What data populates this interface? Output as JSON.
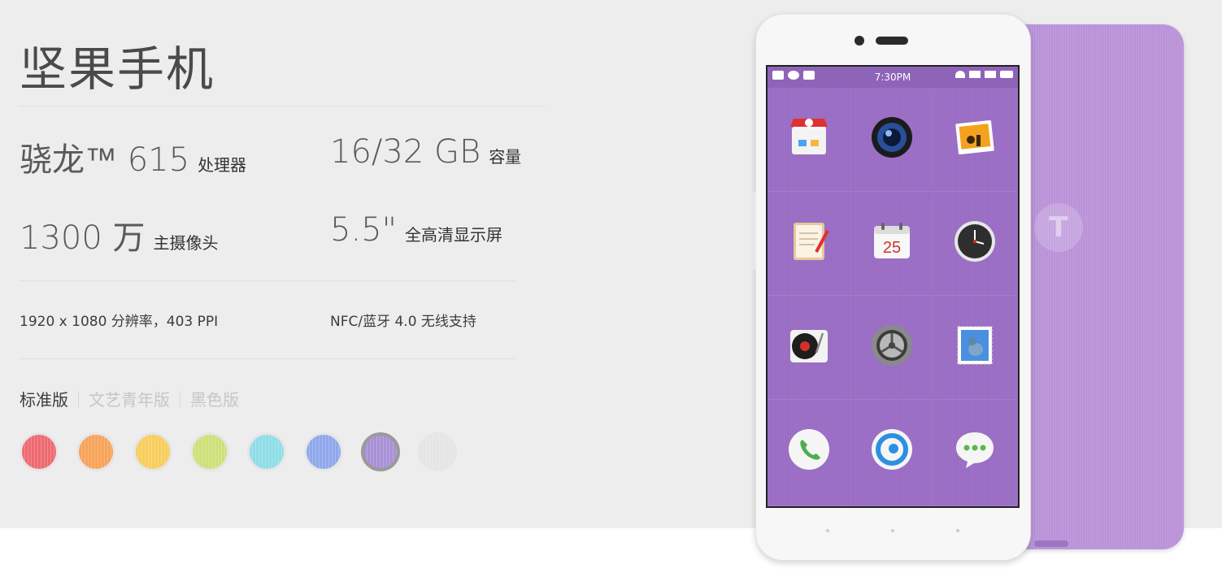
{
  "product": {
    "title": "坚果手机"
  },
  "specs": {
    "processor": {
      "value": "骁龙™ 615",
      "label": "处理器"
    },
    "storage": {
      "value": "16/32 GB",
      "label": "容量"
    },
    "camera": {
      "value": "1300 万",
      "label": "主摄像头"
    },
    "display": {
      "value": "5.5\"",
      "label": "全高清显示屏"
    },
    "resolution": "1920 x 1080  分辨率，403 PPI",
    "wireless": "NFC/蓝牙 4.0   无线支持"
  },
  "editions": [
    "标准版",
    "文艺青年版",
    "黑色版"
  ],
  "active_edition": "标准版",
  "colors": {
    "swatches": [
      "#ee6a72",
      "#f8a35a",
      "#f7cd5d",
      "#cde07a",
      "#8fdde7",
      "#8fa8ec",
      "#a990d6",
      "#e5e5e5"
    ],
    "selected_index": 6
  },
  "phone": {
    "status_time": "7:30PM",
    "calendar_day": "25",
    "back_logo": "T",
    "apps": [
      "store-app-icon",
      "camera-app-icon",
      "gallery-app-icon",
      "notes-app-icon",
      "calendar-app-icon",
      "clock-app-icon",
      "music-app-icon",
      "settings-app-icon",
      "mail-app-icon",
      "phone-app-icon",
      "browser-app-icon",
      "messages-app-icon"
    ]
  }
}
